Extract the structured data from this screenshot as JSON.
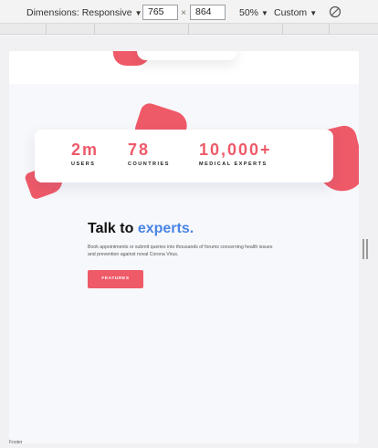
{
  "devtools": {
    "dimensions_label": "Dimensions: Responsive",
    "width_value": "765",
    "times": "×",
    "height_value": "864",
    "zoom": "50%",
    "throttle": "Custom",
    "caret": "▼",
    "rotate_icon": "rotate-icon"
  },
  "stats": [
    {
      "value": "2m",
      "label": "USERS"
    },
    {
      "value": "78",
      "label": "COUNTRIES"
    },
    {
      "value": "10,000+",
      "label": "MEDICAL EXPERTS"
    }
  ],
  "hero": {
    "title_plain": "Talk to ",
    "title_accent": "experts.",
    "description": "Book appointments or submit queries into thousands of forums concerning health issues and prevention against noval Corona Virus.",
    "cta_label": "FEATURES"
  },
  "footer": {
    "label": "Footer"
  },
  "colors": {
    "accent_red": "#ef5a69",
    "accent_blue": "#4a84e6"
  }
}
